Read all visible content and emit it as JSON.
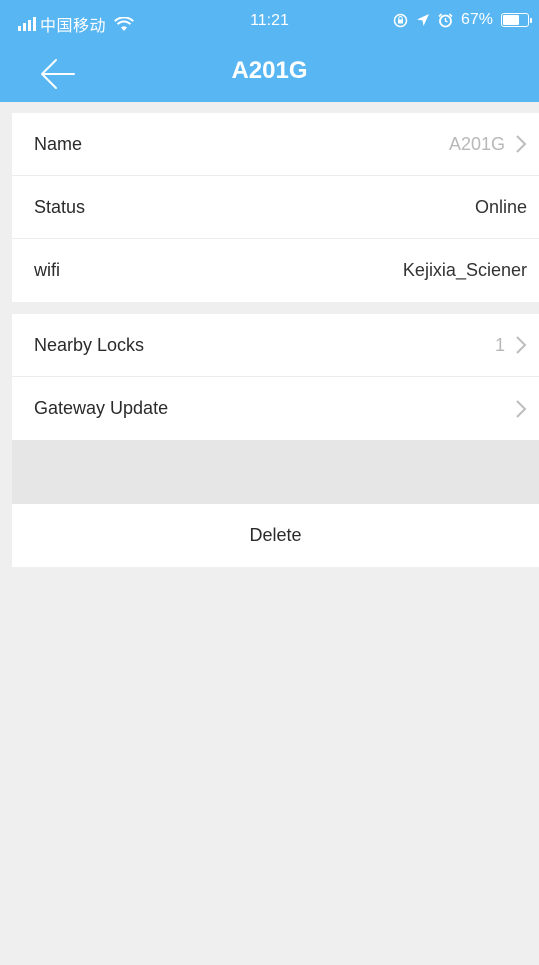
{
  "status_bar": {
    "carrier": "中国移动",
    "time": "11:21",
    "battery_text": "67%",
    "battery_level": 0.67,
    "icons": [
      "signal-icon",
      "wifi-icon",
      "rotation-lock-icon",
      "location-icon",
      "alarm-icon",
      "battery-icon"
    ]
  },
  "nav": {
    "title": "A201G",
    "back_icon": "back-arrow-icon"
  },
  "section1": {
    "rows": [
      {
        "label": "Name",
        "value": "A201G"
      },
      {
        "label": "Status",
        "value": "Online"
      },
      {
        "label": "wifi",
        "value": "Kejixia_Sciener"
      }
    ]
  },
  "section2": {
    "rows": [
      {
        "label": "Nearby Locks",
        "value": "1"
      },
      {
        "label": "Gateway Update",
        "value": ""
      }
    ]
  },
  "actions": {
    "delete_label": "Delete"
  },
  "colors": {
    "header": "#58b6f3",
    "background": "#efefef",
    "muted_text": "#b8b8b8"
  }
}
